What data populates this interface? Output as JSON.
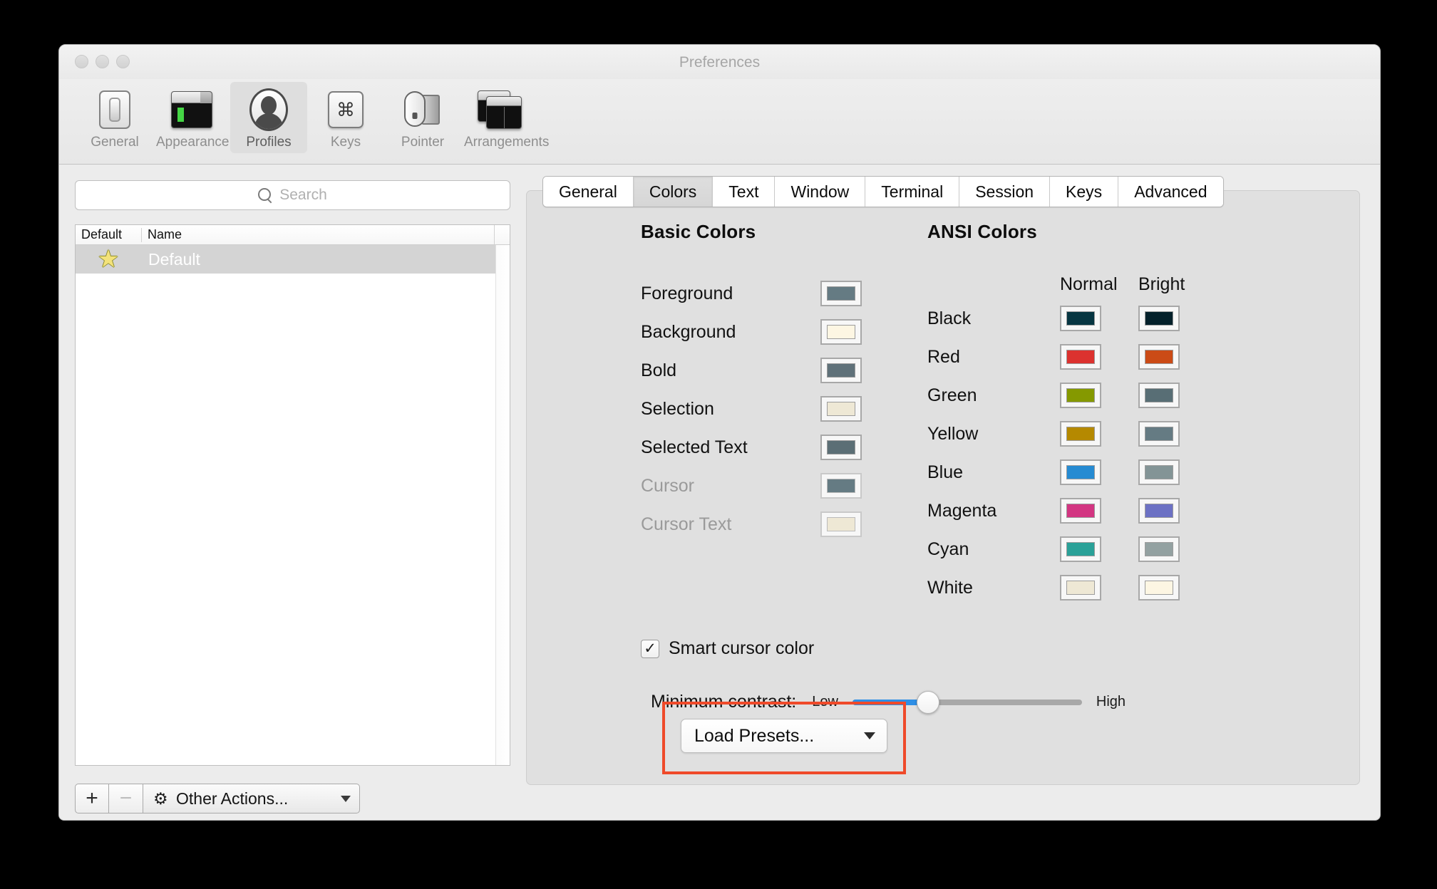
{
  "window": {
    "title": "Preferences",
    "traffic_lights": [
      "close",
      "minimize",
      "zoom"
    ]
  },
  "toolbar": {
    "items": [
      {
        "label": "General",
        "icon": "switch-icon",
        "selected": false
      },
      {
        "label": "Appearance",
        "icon": "window-theme-icon",
        "selected": false
      },
      {
        "label": "Profiles",
        "icon": "user-silhouette-icon",
        "selected": true
      },
      {
        "label": "Keys",
        "icon": "command-key-icon",
        "selected": false
      },
      {
        "label": "Pointer",
        "icon": "mouse-icon",
        "selected": false
      },
      {
        "label": "Arrangements",
        "icon": "windows-stack-icon",
        "selected": false
      }
    ]
  },
  "sidebar": {
    "search": {
      "placeholder": "Search",
      "value": "",
      "icon": "search-icon"
    },
    "columns": [
      "Default",
      "Name"
    ],
    "rows": [
      {
        "default_star": "★",
        "name": "Default",
        "selected": true
      }
    ],
    "footer": {
      "add_label": "+",
      "remove_label": "−",
      "other_actions_label": "Other Actions...",
      "gear_icon": "gear-icon",
      "chevron_icon": "chevron-down-icon"
    }
  },
  "tabs": [
    {
      "label": "General",
      "active": false
    },
    {
      "label": "Colors",
      "active": true
    },
    {
      "label": "Text",
      "active": false
    },
    {
      "label": "Window",
      "active": false
    },
    {
      "label": "Terminal",
      "active": false
    },
    {
      "label": "Session",
      "active": false
    },
    {
      "label": "Keys",
      "active": false
    },
    {
      "label": "Advanced",
      "active": false
    }
  ],
  "basic_colors": {
    "title": "Basic Colors",
    "rows": [
      {
        "label": "Foreground",
        "color": "#657b83",
        "disabled": false
      },
      {
        "label": "Background",
        "color": "#fdf6e3",
        "disabled": false
      },
      {
        "label": "Bold",
        "color": "#5f7179",
        "disabled": false
      },
      {
        "label": "Selection",
        "color": "#eee8d5",
        "disabled": false
      },
      {
        "label": "Selected Text",
        "color": "#5b6e75",
        "disabled": false
      },
      {
        "label": "Cursor",
        "color": "#657b83",
        "disabled": true
      },
      {
        "label": "Cursor Text",
        "color": "#eee8d5",
        "disabled": true
      }
    ]
  },
  "ansi_colors": {
    "title": "ANSI Colors",
    "column_headers": [
      "Normal",
      "Bright"
    ],
    "rows": [
      {
        "label": "Black",
        "normal": "#073642",
        "bright": "#04212b"
      },
      {
        "label": "Red",
        "normal": "#dc322f",
        "bright": "#cb4b16"
      },
      {
        "label": "Green",
        "normal": "#859900",
        "bright": "#586e75"
      },
      {
        "label": "Yellow",
        "normal": "#b58900",
        "bright": "#657b83"
      },
      {
        "label": "Blue",
        "normal": "#268bd2",
        "bright": "#839496"
      },
      {
        "label": "Magenta",
        "normal": "#d33682",
        "bright": "#6c71c4"
      },
      {
        "label": "Cyan",
        "normal": "#2aa198",
        "bright": "#93a1a1"
      },
      {
        "label": "White",
        "normal": "#eee8d5",
        "bright": "#fdf6e3"
      }
    ]
  },
  "options": {
    "smart_cursor_color": {
      "label": "Smart cursor color",
      "checked": true,
      "check_glyph": "✓"
    },
    "minimum_contrast": {
      "caption": "Minimum contrast:",
      "low_label": "Low",
      "high_label": "High",
      "value_percent": 33
    }
  },
  "presets": {
    "button_label": "Load Presets...",
    "chevron_icon": "chevron-down-icon",
    "highlight_color": "#ef4a2a"
  }
}
